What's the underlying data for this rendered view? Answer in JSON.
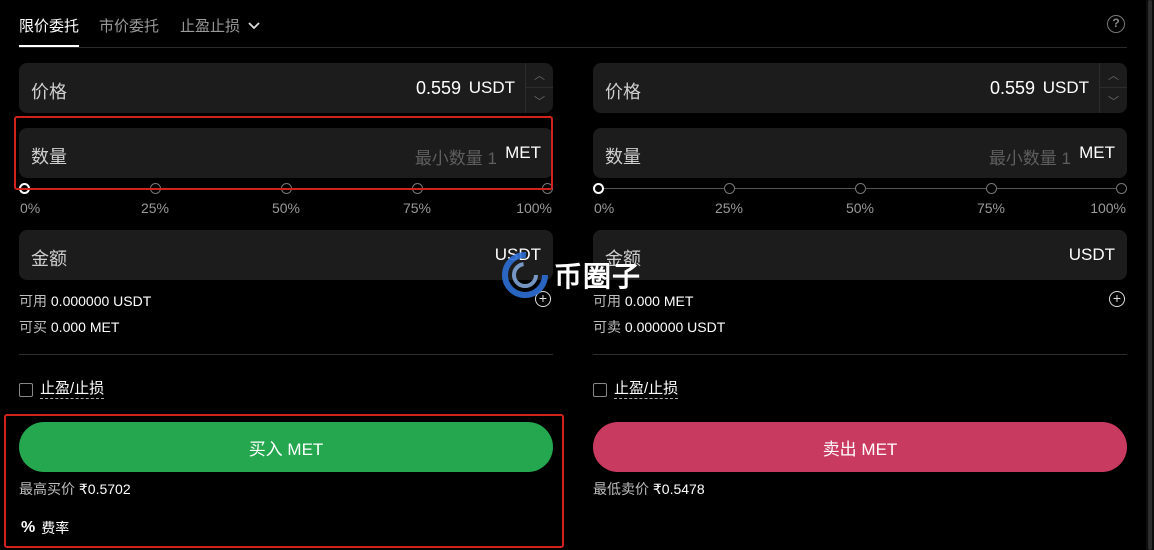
{
  "tabs": [
    {
      "label": "限价委托",
      "active": true
    },
    {
      "label": "市价委托",
      "active": false
    },
    {
      "label": "止盈止损",
      "active": false
    }
  ],
  "help_icon": "question-circle-icon",
  "buy": {
    "price_label": "价格",
    "price_value": "0.559",
    "price_unit": "USDT",
    "qty_label": "数量",
    "qty_placeholder": "最小数量 1",
    "qty_unit": "MET",
    "slider_ticks": [
      "0%",
      "25%",
      "50%",
      "75%",
      "100%"
    ],
    "slider_value_percent": 0,
    "amount_label": "金额",
    "amount_unit": "USDT",
    "available_label": "可用",
    "available_value": "0.000000 USDT",
    "can_trade_label": "可买",
    "can_trade_value": "0.000 MET",
    "tpsl_label": "止盈/止损",
    "button_label": "买入 MET",
    "best_price_label": "最高买价",
    "best_price_value": "₹0.5702",
    "fee_label": "费率"
  },
  "sell": {
    "price_label": "价格",
    "price_value": "0.559",
    "price_unit": "USDT",
    "qty_label": "数量",
    "qty_placeholder": "最小数量 1",
    "qty_unit": "MET",
    "slider_ticks": [
      "0%",
      "25%",
      "50%",
      "75%",
      "100%"
    ],
    "slider_value_percent": 0,
    "amount_label": "金额",
    "amount_unit": "USDT",
    "available_label": "可用",
    "available_value": "0.000 MET",
    "can_trade_label": "可卖",
    "can_trade_value": "0.000000 USDT",
    "tpsl_label": "止盈/止损",
    "button_label": "卖出 MET",
    "best_price_label": "最低卖价",
    "best_price_value": "₹0.5478"
  },
  "watermark": {
    "text": "币圈子"
  },
  "colors": {
    "buy": "#25a750",
    "sell": "#c93a60",
    "highlight": "#d0231e",
    "field_bg": "#1c1c1c"
  }
}
